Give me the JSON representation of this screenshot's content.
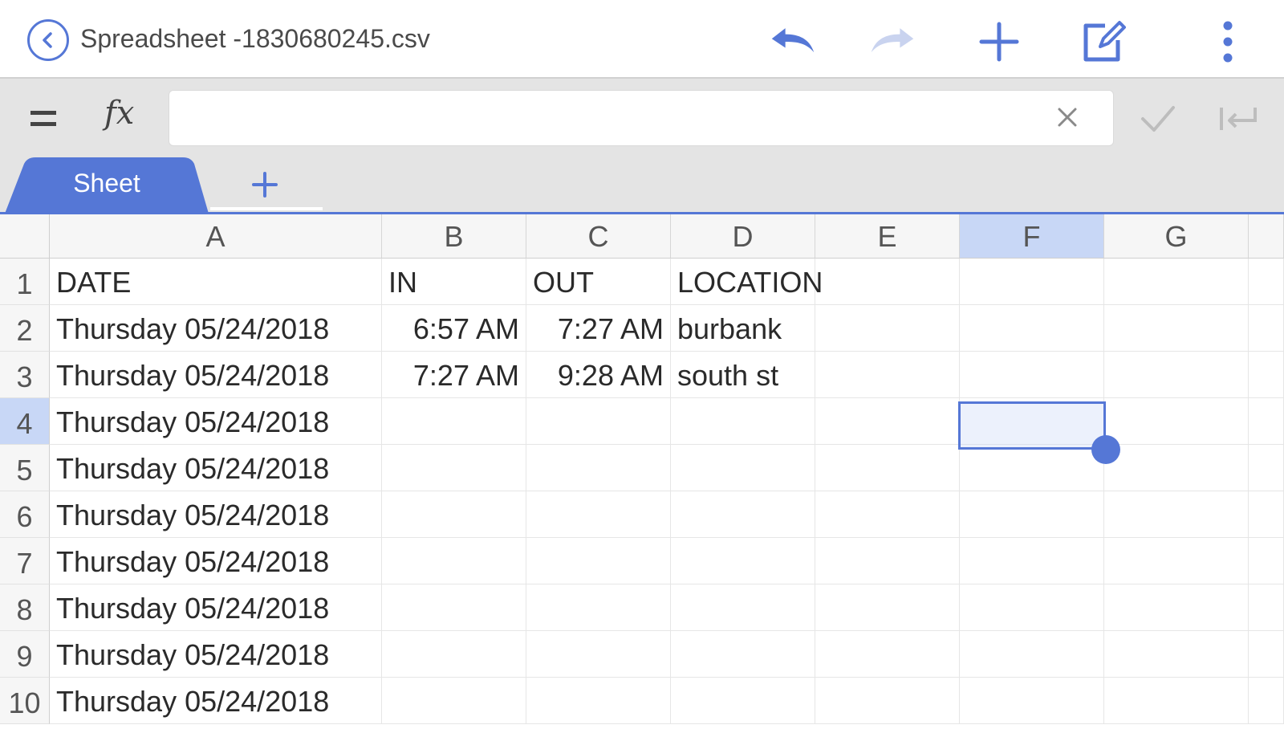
{
  "toolbar": {
    "title": "Spreadsheet -1830680245.csv",
    "icons": [
      "back-icon",
      "undo-icon",
      "redo-icon",
      "add-icon",
      "edit-icon",
      "more-vertical-icon"
    ]
  },
  "formula_bar": {
    "value": "",
    "icons": [
      "menu-equals-icon",
      "function-icon",
      "clear-icon",
      "confirm-icon",
      "enter-icon"
    ],
    "fx_label": "fx"
  },
  "sheets": {
    "tabs": [
      {
        "label": "Sheet",
        "active": true
      }
    ],
    "add_label": "+"
  },
  "colors": {
    "accent": "#5577d6",
    "selected_header": "#c8d7f6",
    "toolbar_bg": "#ffffff",
    "formula_bg": "#e4e4e4"
  },
  "grid": {
    "columns": [
      "A",
      "B",
      "C",
      "D",
      "E",
      "F",
      "G"
    ],
    "selected_column": "F",
    "selected_row": "4",
    "rows": [
      {
        "num": "1",
        "cells": [
          "DATE",
          "IN",
          "OUT",
          "LOCATION",
          "",
          "",
          ""
        ]
      },
      {
        "num": "2",
        "cells": [
          "Thursday 05/24/2018",
          "6:57 AM",
          "7:27 AM",
          "burbank",
          "",
          "",
          ""
        ]
      },
      {
        "num": "3",
        "cells": [
          "Thursday 05/24/2018",
          "7:27 AM",
          "9:28 AM",
          "south st",
          "",
          "",
          ""
        ]
      },
      {
        "num": "4",
        "cells": [
          "Thursday 05/24/2018",
          "",
          "",
          "",
          "",
          "",
          ""
        ]
      },
      {
        "num": "5",
        "cells": [
          "Thursday 05/24/2018",
          "",
          "",
          "",
          "",
          "",
          ""
        ]
      },
      {
        "num": "6",
        "cells": [
          "Thursday 05/24/2018",
          "",
          "",
          "",
          "",
          "",
          ""
        ]
      },
      {
        "num": "7",
        "cells": [
          "Thursday 05/24/2018",
          "",
          "",
          "",
          "",
          "",
          ""
        ]
      },
      {
        "num": "8",
        "cells": [
          "Thursday 05/24/2018",
          "",
          "",
          "",
          "",
          "",
          ""
        ]
      },
      {
        "num": "9",
        "cells": [
          "Thursday 05/24/2018",
          "",
          "",
          "",
          "",
          "",
          ""
        ]
      },
      {
        "num": "10",
        "cells": [
          "Thursday 05/24/2018",
          "",
          "",
          "",
          "",
          "",
          ""
        ]
      }
    ]
  }
}
